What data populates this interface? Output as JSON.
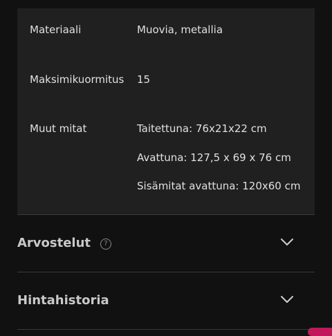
{
  "specs": [
    {
      "label": "Materiaali",
      "values": [
        "Muovia, metallia"
      ]
    },
    {
      "label": "Maksimikuormitus",
      "values": [
        "15"
      ]
    },
    {
      "label": "Muut mitat",
      "values": [
        "Taitettuna: 76x21x22 cm",
        "Avattuna: 127,5 x 69 x 76 cm",
        "Sisämitat avattuna: 120x60 cm"
      ]
    }
  ],
  "sections": [
    {
      "title": "Arvostelut",
      "help_icon": "question-circle-icon",
      "chevron": "chevron-down-icon"
    },
    {
      "title": "Hintahistoria",
      "chevron": "chevron-down-icon"
    }
  ],
  "help_glyph": "?",
  "colors": {
    "background": "#111111",
    "table_background": "#202020",
    "divider": "#3a3a3a",
    "accent": "#c2185b"
  }
}
